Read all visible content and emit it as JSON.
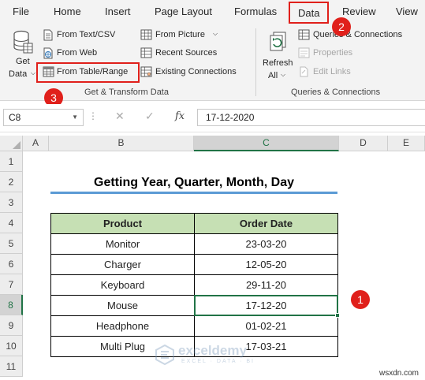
{
  "menu": {
    "tabs": [
      "File",
      "Home",
      "Insert",
      "Page Layout",
      "Formulas",
      "Data",
      "Review",
      "View"
    ],
    "active": "Data"
  },
  "ribbon": {
    "get_data": {
      "line1": "Get",
      "line2": "Data"
    },
    "from_text_csv": "From Text/CSV",
    "from_web": "From Web",
    "from_table_range": "From Table/Range",
    "from_picture": "From Picture",
    "recent_sources": "Recent Sources",
    "existing_connections": "Existing Connections",
    "group_get_transform": "Get & Transform Data",
    "refresh_all": {
      "line1": "Refresh",
      "line2": "All"
    },
    "queries_connections": "Queries & Connections",
    "properties": "Properties",
    "edit_links": "Edit Links",
    "group_queries": "Queries & Connections"
  },
  "badges": {
    "b1": "1",
    "b2": "2",
    "b3": "3"
  },
  "formula_bar": {
    "name_box": "C8",
    "formula": "17-12-2020",
    "fx": "fx"
  },
  "grid": {
    "columns": [
      "A",
      "B",
      "C",
      "D",
      "E"
    ],
    "rows": [
      "1",
      "2",
      "3",
      "4",
      "5",
      "6",
      "7",
      "8",
      "9",
      "10",
      "11"
    ],
    "selected_column": "C",
    "selected_row": "8"
  },
  "sheet": {
    "title": "Getting Year, Quarter, Month, Day",
    "headers": [
      "Product",
      "Order Date"
    ],
    "rows": [
      [
        "Monitor",
        "23-03-20"
      ],
      [
        "Charger",
        "12-05-20"
      ],
      [
        "Keyboard",
        "29-11-20"
      ],
      [
        "Mouse",
        "17-12-20"
      ],
      [
        "Headphone",
        "01-02-21"
      ],
      [
        "Multi Plug",
        "17-03-21"
      ]
    ]
  },
  "watermark": {
    "name": "exceldemy",
    "tagline": "EXCEL · DATA · BI"
  },
  "site": "wsxdn.com",
  "colors": {
    "accent_red": "#e0201b",
    "excel_green": "#217346",
    "header_fill": "#c6e0b4",
    "title_line": "#5b9bd5"
  }
}
